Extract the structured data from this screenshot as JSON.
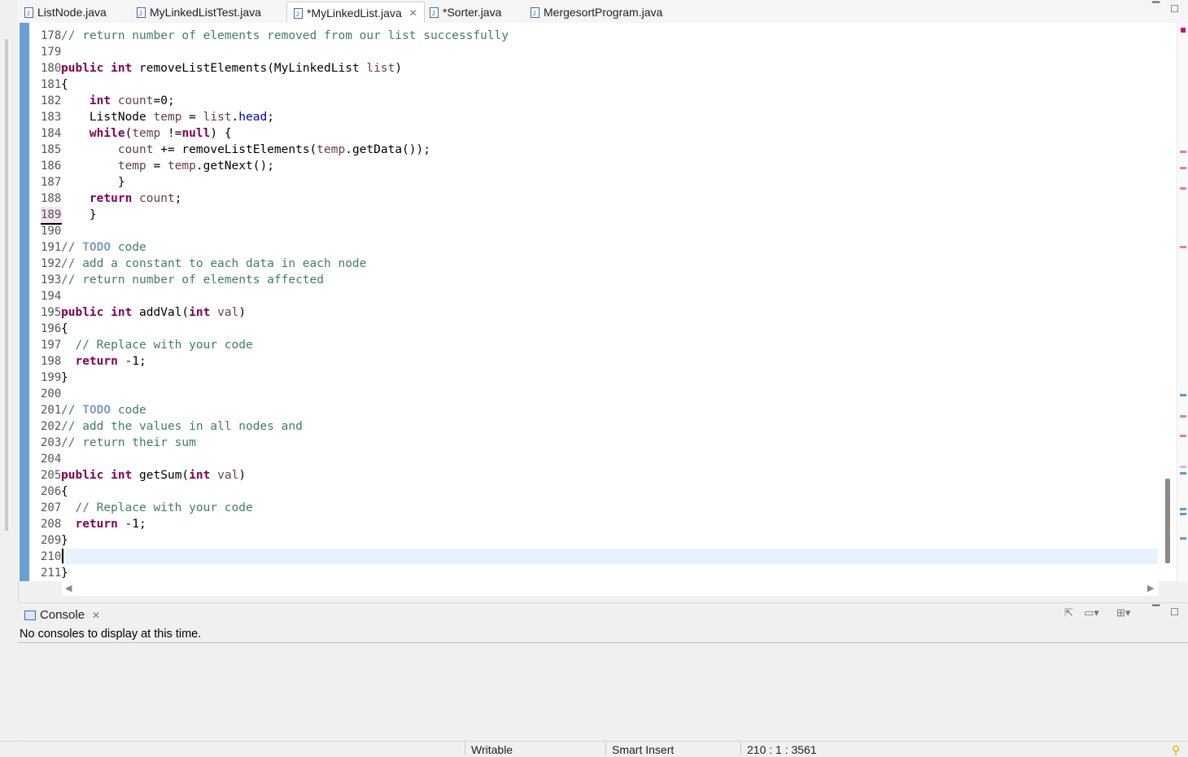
{
  "tabs": [
    {
      "label": "ListNode.java",
      "active": false
    },
    {
      "label": "MyLinkedListTest.java",
      "active": false
    },
    {
      "label": "*MyLinkedList.java",
      "active": true
    },
    {
      "label": "*Sorter.java",
      "active": false
    },
    {
      "label": "MergesortProgram.java",
      "active": false
    }
  ],
  "editor": {
    "line_numbers": [
      "178",
      "179",
      "180",
      "181",
      "182",
      "183",
      "184",
      "185",
      "186",
      "187",
      "188",
      "189",
      "190",
      "191",
      "192",
      "193",
      "194",
      "195",
      "196",
      "197",
      "198",
      "199",
      "200",
      "201",
      "202",
      "203",
      "204",
      "205",
      "206",
      "207",
      "208",
      "209",
      "210",
      "211"
    ],
    "current_line": "210"
  },
  "console": {
    "tab_label": "Console",
    "message": "No consoles to display at this time."
  },
  "status": {
    "mode": "Writable",
    "insert": "Smart Insert",
    "position": "210 : 1 : 3561"
  },
  "colors": {
    "keyword": "#7f0055",
    "comment": "#3f7f5f",
    "todo": "#7f9fbf",
    "current_line": "#e8f2fe",
    "overview_marks": [
      "#e0006e",
      "#5b9bd5"
    ]
  }
}
